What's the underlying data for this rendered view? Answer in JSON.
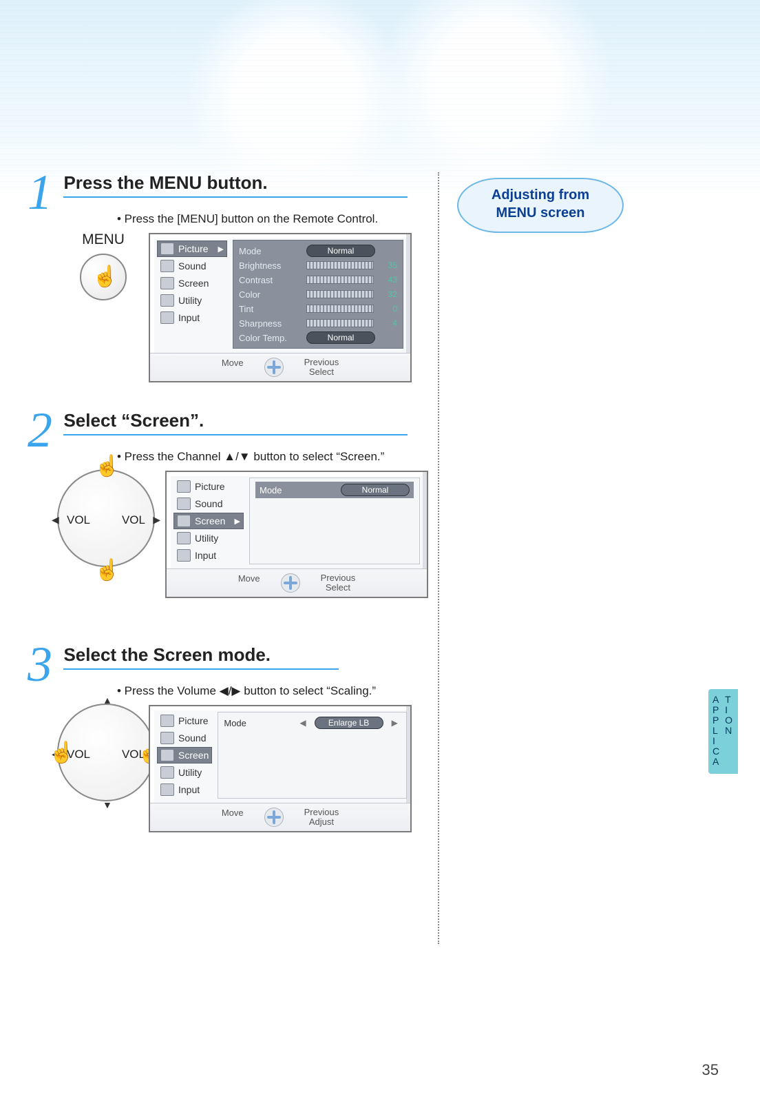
{
  "page_number": "35",
  "side_title_line1": "Adjusting from",
  "side_title_line2": "MENU screen",
  "side_tab": {
    "col1": [
      "A",
      "P",
      "P",
      "L",
      "I",
      "C",
      "A"
    ],
    "col2": [
      "T",
      "I",
      "O",
      "N",
      "",
      "",
      ""
    ]
  },
  "remote": {
    "menu_caption": "MENU",
    "vol_label": "VOL"
  },
  "steps": [
    {
      "num": "1",
      "title": "Press the MENU button.",
      "note": "• Press the [MENU] button on the Remote Control.",
      "osd": {
        "menu": [
          {
            "label": "Picture",
            "selected": true,
            "arrow": true
          },
          {
            "label": "Sound"
          },
          {
            "label": "Screen"
          },
          {
            "label": "Utility"
          },
          {
            "label": "Input"
          }
        ],
        "pane_style": "dark",
        "pane": [
          {
            "k": "Mode",
            "type": "pill",
            "v": "Normal"
          },
          {
            "k": "Brightness",
            "type": "bar",
            "v": "35"
          },
          {
            "k": "Contrast",
            "type": "bar",
            "v": "43"
          },
          {
            "k": "Color",
            "type": "bar",
            "v": "32"
          },
          {
            "k": "Tint",
            "type": "bar",
            "v": "0"
          },
          {
            "k": "Sharpness",
            "type": "bar",
            "v": "4"
          },
          {
            "k": "Color Temp.",
            "type": "pill",
            "v": "Normal"
          }
        ],
        "foot": {
          "move": "Move",
          "previous": "Previous",
          "select": "Select"
        }
      }
    },
    {
      "num": "2",
      "title": "Select “Screen”.",
      "note": "• Press the Channel ▲/▼ button to select “Screen.”",
      "osd": {
        "menu": [
          {
            "label": "Picture"
          },
          {
            "label": "Sound"
          },
          {
            "label": "Screen",
            "selected": true,
            "arrow": true
          },
          {
            "label": "Utility"
          },
          {
            "label": "Input"
          }
        ],
        "pane_style": "light",
        "pane": [
          {
            "k": "Mode",
            "type": "sel-pill",
            "v": "Normal"
          }
        ],
        "foot": {
          "move": "Move",
          "previous": "Previous",
          "select": "Select"
        }
      }
    },
    {
      "num": "3",
      "title": "Select the Screen mode.",
      "note": "• Press the Volume ◀/▶ button to select “Scaling.”",
      "osd": {
        "menu": [
          {
            "label": "Picture"
          },
          {
            "label": "Sound"
          },
          {
            "label": "Screen",
            "selected": true
          },
          {
            "label": "Utility"
          },
          {
            "label": "Input"
          }
        ],
        "pane_style": "light",
        "pane": [
          {
            "k": "Mode",
            "type": "lr-pill",
            "v": "Enlarge LB"
          }
        ],
        "foot": {
          "move": "Move",
          "previous": "Previous",
          "select": "Adjust"
        }
      }
    }
  ]
}
